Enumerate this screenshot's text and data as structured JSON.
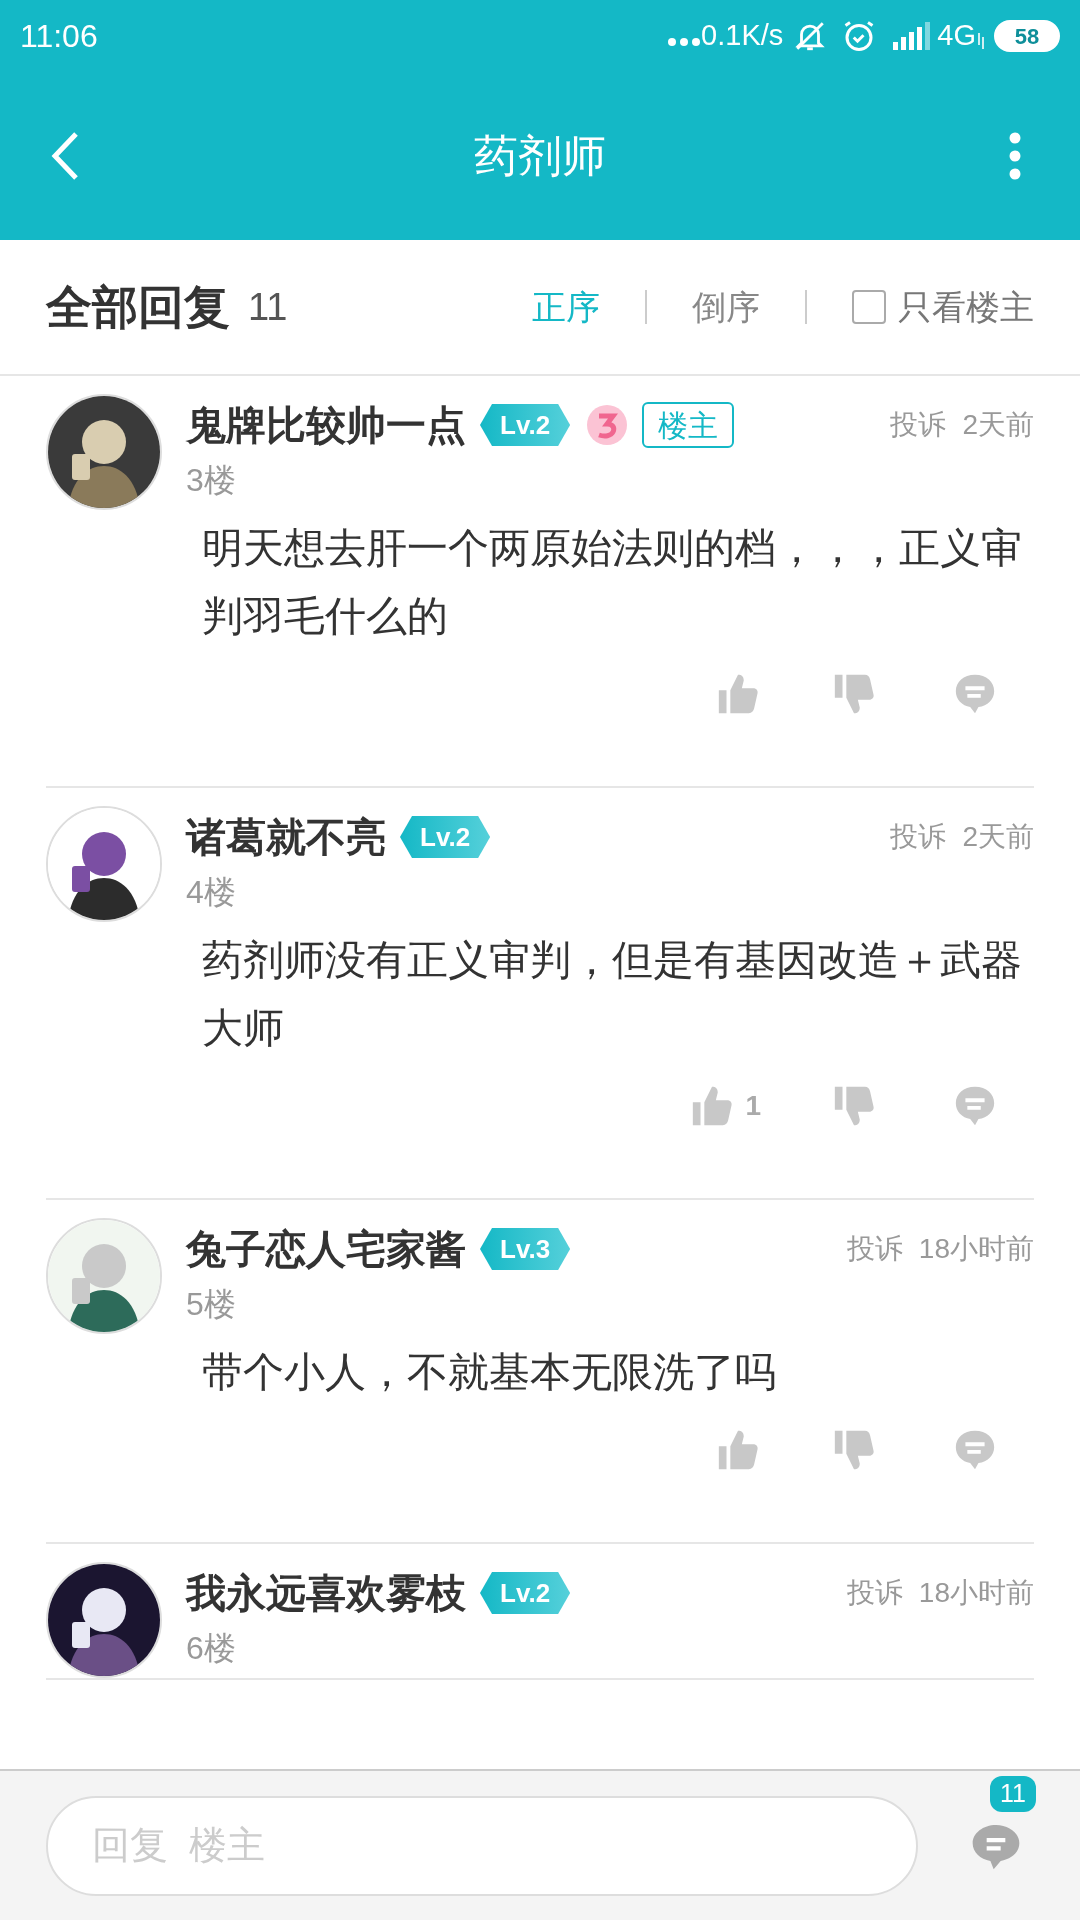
{
  "status_bar": {
    "time": "11:06",
    "network_speed": "0.1K/s",
    "network_type": "4G",
    "battery": "58"
  },
  "header": {
    "title": "药剂师"
  },
  "reply_bar": {
    "title": "全部回复",
    "count": "11",
    "sort_options": [
      {
        "label": "正序",
        "selected": true
      },
      {
        "label": "倒序",
        "selected": false
      }
    ],
    "owner_only": {
      "label": "只看楼主",
      "checked": false
    }
  },
  "posts": [
    {
      "author": "鬼牌比较帅一点",
      "level": "Lv.2",
      "special_badge": true,
      "owner_tag": "楼主",
      "floor": "3楼",
      "report": "投诉",
      "time": "2天前",
      "body": "明天想去肝一个两原始法则的档，，，正义审判羽毛什么的"
    },
    {
      "author": "诸葛就不亮",
      "level": "Lv.2",
      "special_badge": false,
      "floor": "4楼",
      "report": "投诉",
      "time": "2天前",
      "body": "药剂师没有正义审判，但是有基因改造＋武器大师",
      "likes": "1"
    },
    {
      "author": "兔子恋人宅家酱",
      "level": "Lv.3",
      "special_badge": false,
      "floor": "5楼",
      "report": "投诉",
      "time": "18小时前",
      "body": "带个小人，不就基本无限洗了吗"
    },
    {
      "author": "我永远喜欢雾枝",
      "level": "Lv.2",
      "special_badge": false,
      "floor": "6楼",
      "report": "投诉",
      "time": "18小时前"
    }
  ],
  "composer": {
    "placeholder": "回复  楼主",
    "comment_count": "11"
  }
}
